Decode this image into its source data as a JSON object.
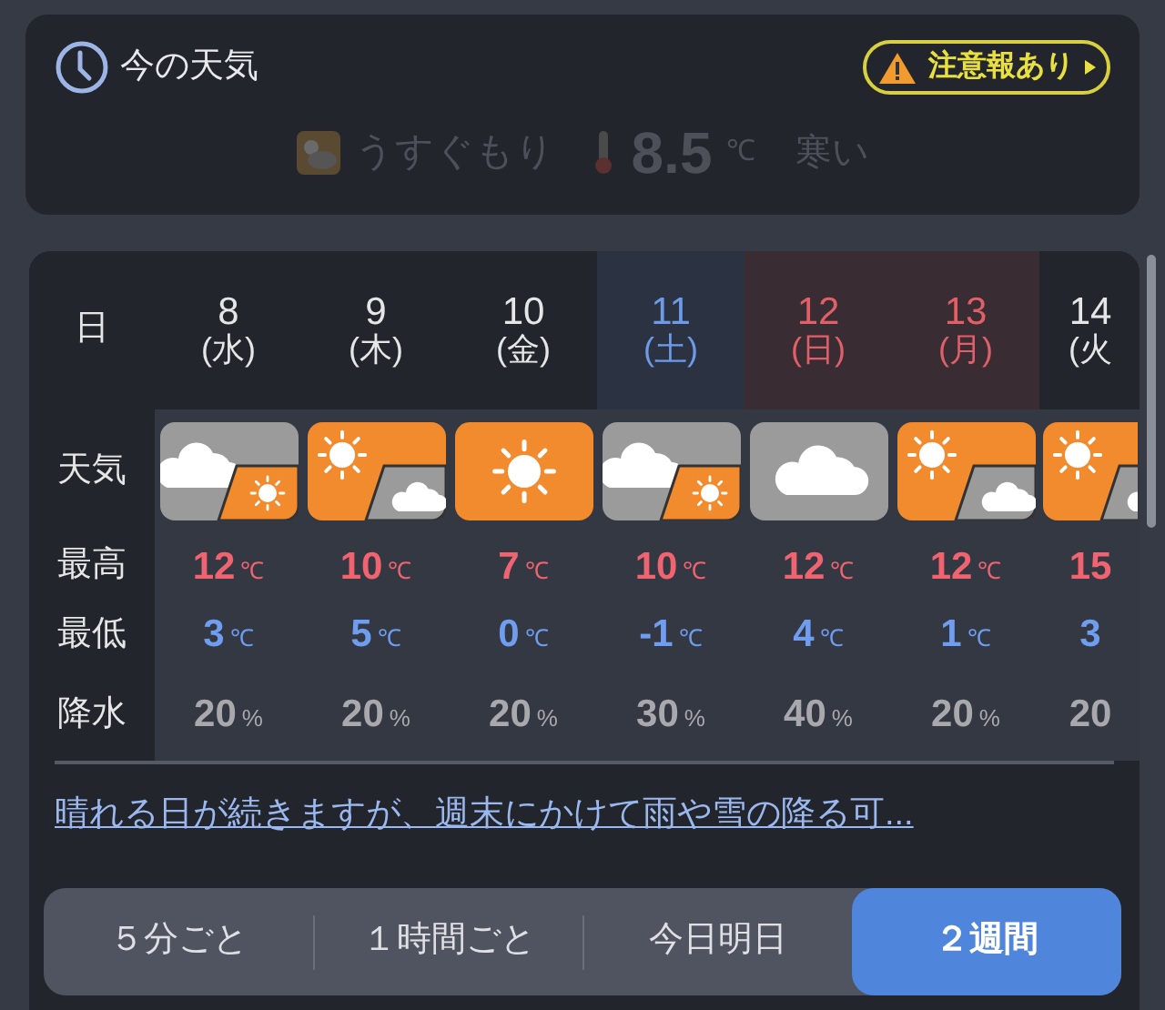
{
  "now": {
    "title": "今の天気",
    "warning": "注意報あり",
    "condition": "うすぐもり",
    "temp": "8.5",
    "unit": "℃",
    "feeling": "寒い"
  },
  "row_labels": [
    "日",
    "天気",
    "最高",
    "最低",
    "降水"
  ],
  "days": [
    {
      "date": "8",
      "weekday": "(水)",
      "color": "#e6e6e6",
      "highlighted": false,
      "weather": {
        "kind": "cloudsun"
      },
      "high": "12",
      "high_unit": "℃",
      "low": "3",
      "low_unit": "℃",
      "precip": "20",
      "precip_unit": "%"
    },
    {
      "date": "9",
      "weekday": "(木)",
      "color": "#e6e6e6",
      "highlighted": false,
      "weather": {
        "kind": "suncloud"
      },
      "high": "10",
      "high_unit": "℃",
      "low": "5",
      "low_unit": "℃",
      "precip": "20",
      "precip_unit": "%"
    },
    {
      "date": "10",
      "weekday": "(金)",
      "color": "#e6e6e6",
      "highlighted": false,
      "weather": {
        "kind": "sun"
      },
      "high": "7",
      "high_unit": "℃",
      "low": "0",
      "low_unit": "℃",
      "precip": "20",
      "precip_unit": "%"
    },
    {
      "date": "11",
      "weekday": "(土)",
      "color": "#6f9ae8",
      "highlighted": true,
      "weather": {
        "kind": "cloudsun"
      },
      "high": "10",
      "high_unit": "℃",
      "low": "-1",
      "low_unit": "℃",
      "precip": "30",
      "precip_unit": "%"
    },
    {
      "date": "12",
      "weekday": "(日)",
      "color": "#e0606a",
      "highlighted": true,
      "weather": {
        "kind": "cloud"
      },
      "high": "12",
      "high_unit": "℃",
      "low": "4",
      "low_unit": "℃",
      "precip": "40",
      "precip_unit": "%"
    },
    {
      "date": "13",
      "weekday": "(月)",
      "color": "#e0606a",
      "highlighted": true,
      "weather": {
        "kind": "suncloud"
      },
      "high": "12",
      "high_unit": "℃",
      "low": "1",
      "low_unit": "℃",
      "precip": "20",
      "precip_unit": "%"
    },
    {
      "date": "14",
      "weekday": "(火",
      "color": "#e6e6e6",
      "highlighted": false,
      "weather": {
        "kind": "suncloud"
      },
      "high": "15",
      "low": "3",
      "precip": "20"
    }
  ],
  "summary_link": "晴れる日が続きますが、週末にかけて雨や雪の降る可...",
  "tabs": [
    {
      "label": "５分ごと",
      "selected": false
    },
    {
      "label": "１時間ごと",
      "selected": false
    },
    {
      "label": "今日明日",
      "selected": false
    },
    {
      "label": "２週間",
      "selected": true
    }
  ]
}
